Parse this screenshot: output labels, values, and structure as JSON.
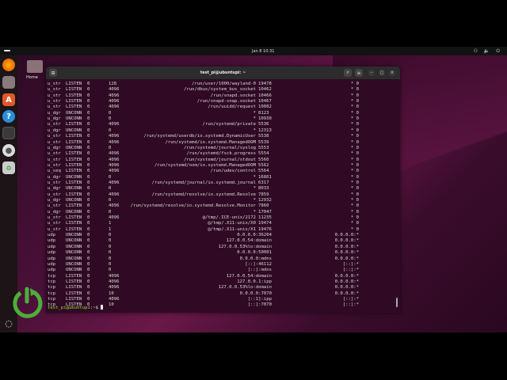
{
  "topbar": {
    "clock": "Jan 8  10:31",
    "tray": "⚇ 🔈 ⏻"
  },
  "desktop": {
    "home_label": "Home"
  },
  "terminal": {
    "title": "test_pi@ubuntupi: ~",
    "prompt_user": "test_pi@ubuntupi",
    "prompt_rest": ":~$ "
  },
  "rows": [
    [
      "u_str",
      "LISTEN",
      "0",
      "128",
      "/run/user/1000/wayland-0",
      "19478",
      "* 0"
    ],
    [
      "u_str",
      "LISTEN",
      "0",
      "4096",
      "/run/dbus/system_bus_socket",
      "10462",
      "* 0"
    ],
    [
      "u_str",
      "LISTEN",
      "0",
      "4096",
      "/run/snapd.socket",
      "10466",
      "* 0"
    ],
    [
      "u_str",
      "LISTEN",
      "0",
      "4096",
      "/run/snapd-snap.socket",
      "10467",
      "* 0"
    ],
    [
      "u_str",
      "LISTEN",
      "0",
      "4096",
      "/run/uuidd/request",
      "10082",
      "* 0"
    ],
    [
      "u_dgr",
      "UNCONN",
      "0",
      "0",
      "*",
      "8123",
      "* 0"
    ],
    [
      "u_dgr",
      "UNCONN",
      "0",
      "0",
      "*",
      "10930",
      "* 0"
    ],
    [
      "u_str",
      "LISTEN",
      "0",
      "4096",
      "/run/systemd/private",
      "5536",
      "* 0"
    ],
    [
      "u_dgr",
      "UNCONN",
      "0",
      "0",
      "*",
      "12313",
      "* 0"
    ],
    [
      "u_str",
      "LISTEN",
      "0",
      "4096",
      "/run/systemd/userdb/io.systemd.DynamicUser",
      "5538",
      "* 0"
    ],
    [
      "u_str",
      "LISTEN",
      "0",
      "4096",
      "/run/systemd/io.systemd.ManagedOOM",
      "5539",
      "* 0"
    ],
    [
      "u_dgr",
      "UNCONN",
      "0",
      "0",
      "/run/systemd/journal/syslog",
      "5553",
      "* 0"
    ],
    [
      "u_str",
      "LISTEN",
      "0",
      "4096",
      "/run/systemd/fsck.progress",
      "5554",
      "* 0"
    ],
    [
      "u_str",
      "LISTEN",
      "0",
      "4096",
      "/run/systemd/journal/stdout",
      "5560",
      "* 0"
    ],
    [
      "u_str",
      "LISTEN",
      "0",
      "4096",
      "/run/systemd/oom/io.systemd.ManagedOOM",
      "5562",
      "* 0"
    ],
    [
      "u_seq",
      "LISTEN",
      "0",
      "4096",
      "/run/udev/control",
      "5564",
      "* 0"
    ],
    [
      "u_dgr",
      "UNCONN",
      "0",
      "0",
      "*",
      "16801",
      "* 0"
    ],
    [
      "u_str",
      "LISTEN",
      "0",
      "4096",
      "/run/systemd/journal/io.systemd.journal",
      "6317",
      "* 0"
    ],
    [
      "u_dgr",
      "UNCONN",
      "0",
      "0",
      "*",
      "8033",
      "* 0"
    ],
    [
      "u_str",
      "LISTEN",
      "0",
      "4096",
      "/run/systemd/resolve/io.systemd.Resolve",
      "7859",
      "* 0"
    ],
    [
      "u_dgr",
      "UNCONN",
      "0",
      "0",
      "*",
      "12932",
      "* 0"
    ],
    [
      "u_str",
      "LISTEN",
      "0",
      "4096",
      "/run/systemd/resolve/io.systemd.Resolve.Monitor",
      "7860",
      "* 0"
    ],
    [
      "u_dgr",
      "UNCONN",
      "0",
      "0",
      "*",
      "17047",
      "* 0"
    ],
    [
      "u_str",
      "LISTEN",
      "0",
      "4096",
      "@/tmp/.ICE-unix/2172",
      "11235",
      "* 0"
    ],
    [
      "u_str",
      "LISTEN",
      "0",
      "1",
      "@/tmp/.X11-unix/X0",
      "19474",
      "* 0"
    ],
    [
      "u_str",
      "LISTEN",
      "0",
      "1",
      "@/tmp/.X11-unix/X1",
      "19476",
      "* 0"
    ],
    [
      "udp",
      "UNCONN",
      "0",
      "0",
      "0.0.0.0:36204",
      "",
      "0.0.0.0:*"
    ],
    [
      "udp",
      "UNCONN",
      "0",
      "0",
      "127.0.0.54:domain",
      "",
      "0.0.0.0:*"
    ],
    [
      "udp",
      "UNCONN",
      "0",
      "0",
      "127.0.0.53%lo:domain",
      "",
      "0.0.0.0:*"
    ],
    [
      "udp",
      "UNCONN",
      "0",
      "0",
      "0.0.0.0:50001",
      "",
      "0.0.0.0:*"
    ],
    [
      "udp",
      "UNCONN",
      "0",
      "0",
      "0.0.0.0:mdns",
      "",
      "0.0.0.0:*"
    ],
    [
      "udp",
      "UNCONN",
      "0",
      "0",
      "[::]:46112",
      "",
      "[::]:*"
    ],
    [
      "udp",
      "UNCONN",
      "0",
      "0",
      "[::]:mdns",
      "",
      "[::]:*"
    ],
    [
      "tcp",
      "LISTEN",
      "0",
      "4096",
      "127.0.0.54:domain",
      "",
      "0.0.0.0:*"
    ],
    [
      "tcp",
      "LISTEN",
      "0",
      "4096",
      "127.0.0.1:ipp",
      "",
      "0.0.0.0:*"
    ],
    [
      "tcp",
      "LISTEN",
      "0",
      "4096",
      "127.0.0.53%lo:domain",
      "",
      "0.0.0.0:*"
    ],
    [
      "tcp",
      "LISTEN",
      "0",
      "10",
      "0.0.0.0:7070",
      "",
      "0.0.0.0:*"
    ],
    [
      "tcp",
      "LISTEN",
      "0",
      "4096",
      "[::1]:ipp",
      "",
      "[::]:*"
    ],
    [
      "tcp",
      "LISTEN",
      "0",
      "10",
      "[::]:7070",
      "",
      "[::]:*"
    ]
  ]
}
